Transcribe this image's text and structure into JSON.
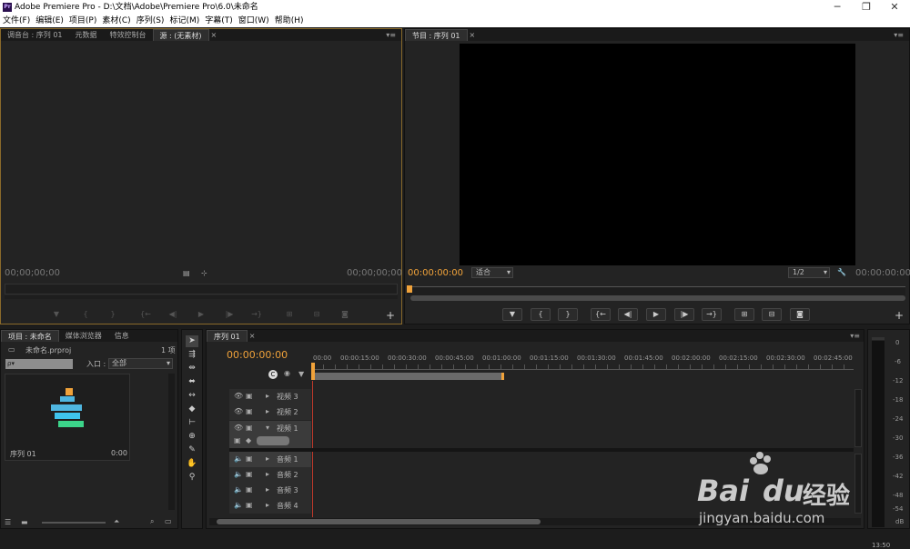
{
  "titlebar": {
    "logo": "Pr",
    "title": "Adobe Premiere Pro - D:\\文档\\Adobe\\Premiere Pro\\6.0\\未命名",
    "minimize": "─",
    "maximize": "❐",
    "close": "✕"
  },
  "menu": [
    "文件(F)",
    "编辑(E)",
    "项目(P)",
    "素材(C)",
    "序列(S)",
    "标记(M)",
    "字幕(T)",
    "窗口(W)",
    "帮助(H)"
  ],
  "source_panel": {
    "tabs": [
      "调音台 : 序列 01",
      "元数据",
      "特效控制台",
      "源 : (无素材)"
    ],
    "timecode_in": "00;00;00;00",
    "timecode_out": "00;00;00;00"
  },
  "program_panel": {
    "tab": "节目 : 序列 01",
    "timecode": "00:00:00:00",
    "fit": "适合",
    "resolution": "1/2",
    "duration": "00:00:00:00"
  },
  "transport": {
    "marker": "▼",
    "mark_in": "{",
    "mark_out": "}",
    "go_in": "{←",
    "step_back": "◀|",
    "play": "▶",
    "step_fwd": "|▶",
    "go_out": "→}",
    "lift": "⊞",
    "extract": "⊟",
    "export_frame": "◙"
  },
  "project_panel": {
    "tabs": [
      "项目 : 未命名",
      "媒体浏览器",
      "信息"
    ],
    "filename": "未命名.prproj",
    "count": "1 项",
    "search_placeholder": "ρ▾",
    "in_label": "入口 :",
    "in_value": "全部",
    "item_name": "序列 01",
    "item_duration": "0:00"
  },
  "timeline": {
    "tab": "序列 01",
    "timecode": "00:00:00:00",
    "ruler": [
      "00:00",
      "00:00:15:00",
      "00:00:30:00",
      "00:00:45:00",
      "00:01:00:00",
      "00:01:15:00",
      "00:01:30:00",
      "00:01:45:00",
      "00:02:00:00",
      "00:02:15:00",
      "00:02:30:00",
      "00:02:45:00"
    ],
    "video_tracks": [
      "视频 3",
      "视频 2",
      "视频 1"
    ],
    "audio_tracks": [
      "音频 1",
      "音频 2",
      "音频 3",
      "音频 4"
    ]
  },
  "meter": {
    "scale": [
      "0",
      "-6",
      "-12",
      "-18",
      "-24",
      "-30",
      "-36",
      "-42",
      "-48",
      "-54",
      "dB"
    ]
  },
  "watermark": {
    "brand": "Bai",
    "brand2": "du",
    "cn": "经验",
    "url": "jingyan.baidu.com"
  },
  "status": {
    "clock": "13:50"
  }
}
